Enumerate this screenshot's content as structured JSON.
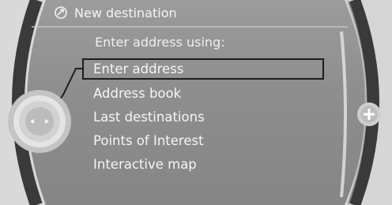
{
  "header": {
    "title": "New destination",
    "icon": "navigation-target-icon"
  },
  "subtitle": "Enter address using:",
  "menu": {
    "selected_index": 0,
    "items": [
      {
        "label": "Enter address"
      },
      {
        "label": "Address book"
      },
      {
        "label": "Last destinations"
      },
      {
        "label": "Points of Interest"
      },
      {
        "label": "Interactive map"
      }
    ]
  },
  "controller": {
    "icon": "controller-knob-icon"
  },
  "side_button": {
    "icon": "plus-icon"
  },
  "colors": {
    "panel": "#8f8f8f",
    "text": "#f4f4f4",
    "selection": "#1d1d1d"
  }
}
